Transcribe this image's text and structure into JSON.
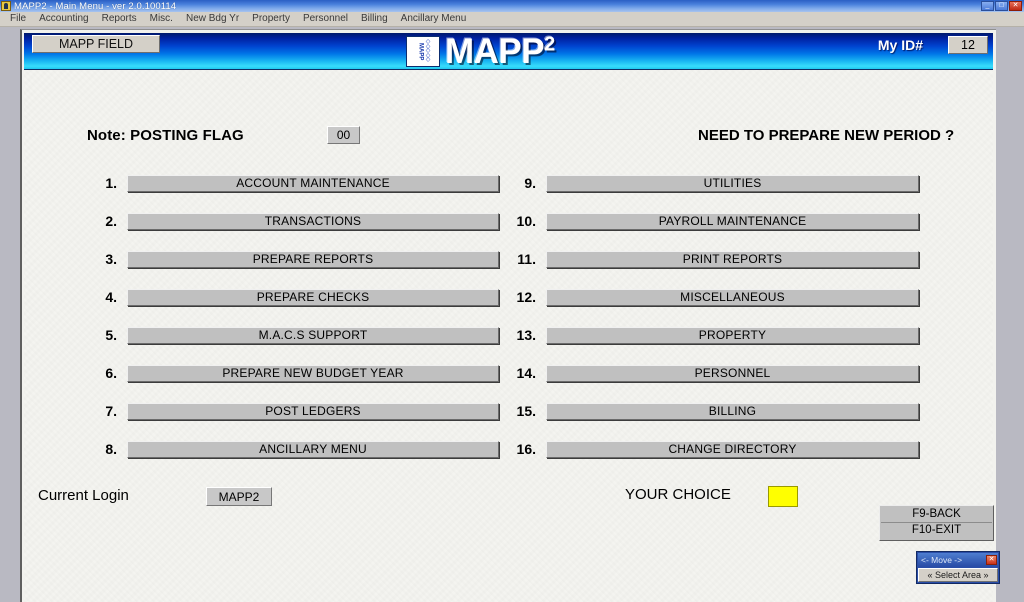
{
  "window": {
    "title": "MAPP2 - Main Menu - ver 2.0.100114",
    "icon": "app-icon",
    "minimize_label": "_",
    "maximize_label": "□",
    "close_label": "✕"
  },
  "menubar": {
    "items": [
      "File",
      "Accounting",
      "Reports",
      "Misc.",
      "New Bdg Yr",
      "Property",
      "Personnel",
      "Billing",
      "Ancillary Menu"
    ]
  },
  "banner": {
    "field_label": "MAPP FIELD",
    "logo_text": "MAPP",
    "logo_superscript": "2",
    "logo_box_vertical_text": "MAPP",
    "my_id_label": "My ID#",
    "my_id_value": "12",
    "gradient_top": "#00196b",
    "gradient_bottom": "#38dcfb"
  },
  "main": {
    "note_label": "Note: POSTING FLAG",
    "note_value": "00",
    "prompt_question": "NEED TO PREPARE NEW PERIOD ?",
    "menu_left": [
      {
        "number": "1.",
        "label": "ACCOUNT MAINTENANCE"
      },
      {
        "number": "2.",
        "label": "TRANSACTIONS"
      },
      {
        "number": "3.",
        "label": "PREPARE REPORTS"
      },
      {
        "number": "4.",
        "label": "PREPARE CHECKS"
      },
      {
        "number": "5.",
        "label": "M.A.C.S SUPPORT"
      },
      {
        "number": "6.",
        "label": "PREPARE NEW BUDGET YEAR"
      },
      {
        "number": "7.",
        "label": "POST LEDGERS"
      },
      {
        "number": "8.",
        "label": "ANCILLARY MENU"
      }
    ],
    "menu_right": [
      {
        "number": "9.",
        "label": "UTILITIES"
      },
      {
        "number": "10.",
        "label": "PAYROLL MAINTENANCE"
      },
      {
        "number": "11.",
        "label": "PRINT REPORTS"
      },
      {
        "number": "12.",
        "label": "MISCELLANEOUS"
      },
      {
        "number": "13.",
        "label": "PROPERTY"
      },
      {
        "number": "14.",
        "label": "PERSONNEL"
      },
      {
        "number": "15.",
        "label": "BILLING"
      },
      {
        "number": "16.",
        "label": "CHANGE DIRECTORY"
      }
    ],
    "current_login_label": "Current Login",
    "current_login_value": "MAPP2",
    "your_choice_label": "YOUR CHOICE",
    "your_choice_value": "",
    "your_choice_color": "#ffff00",
    "fkeys": [
      {
        "label": "F9-BACK"
      },
      {
        "label": "F10-EXIT"
      }
    ]
  },
  "move_widget": {
    "title": "<- Move ->",
    "close_label": "✕",
    "button_label": "« Select Area »"
  }
}
